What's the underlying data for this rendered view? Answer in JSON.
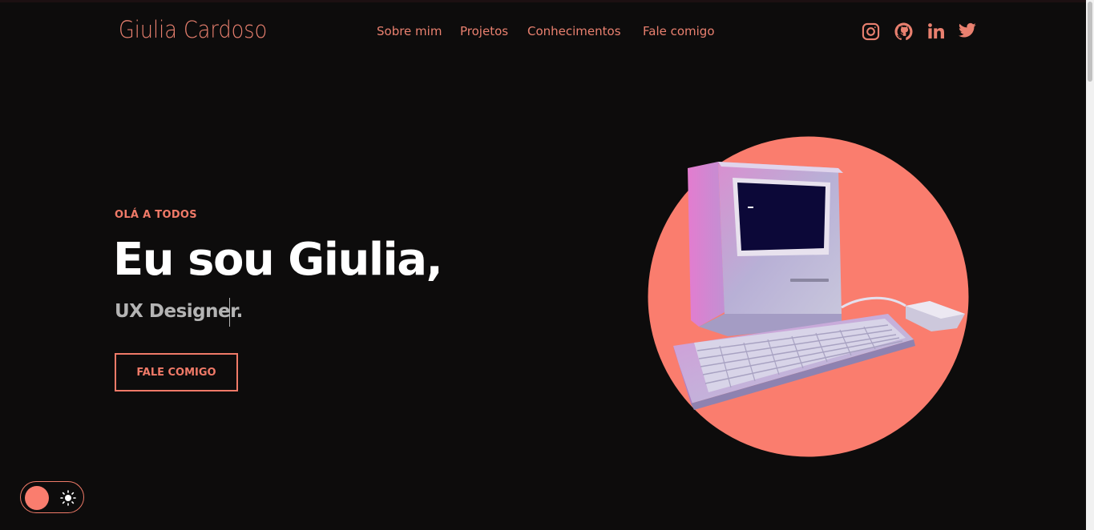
{
  "brand": {
    "name": "Giulia Cardoso"
  },
  "nav": {
    "items": [
      {
        "label": "Sobre mim"
      },
      {
        "label": "Projetos"
      },
      {
        "label": "Conhecimentos"
      },
      {
        "label": "Fale comigo"
      }
    ]
  },
  "social": {
    "items": [
      {
        "icon": "instagram-icon"
      },
      {
        "icon": "github-icon"
      },
      {
        "icon": "linkedin-icon"
      },
      {
        "icon": "twitter-icon"
      }
    ]
  },
  "hero": {
    "kicker": "OLÁ A TODOS",
    "title": "Eu sou Giulia,",
    "subtitle": "UX Designer.",
    "cta_label": "FALE COMIGO",
    "image_icon": "retro-computer-illustration"
  },
  "theme_toggle": {
    "icon": "sun-icon",
    "mode": "dark"
  },
  "colors": {
    "accent": "#f07a68",
    "background": "#0d0c0c",
    "circle": "#fa7d6e",
    "subtitle": "#b4b4b4"
  }
}
